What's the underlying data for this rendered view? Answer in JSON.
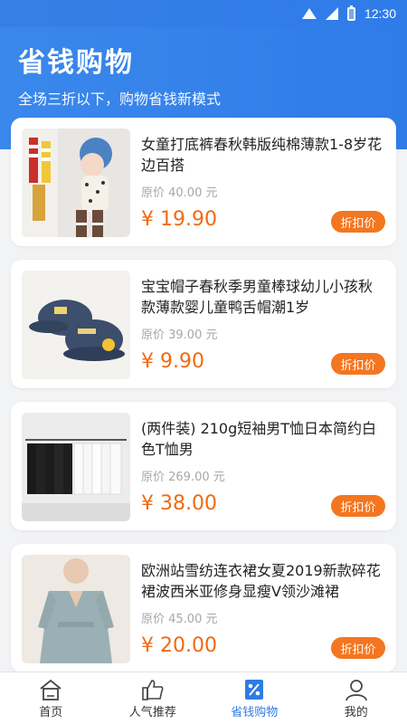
{
  "status_bar": {
    "time": "12:30"
  },
  "header": {
    "title": "省钱购物",
    "subtitle": "全场三折以下，购物省钱新模式"
  },
  "products": [
    {
      "title": "女童打底裤春秋韩版纯棉薄款1-8岁花边百搭",
      "original_price": "原价 40.00 元",
      "price": "¥ 19.90",
      "badge": "折扣价",
      "image": "girl-leggings"
    },
    {
      "title": "宝宝帽子春秋季男童棒球幼儿小孩秋款薄款婴儿童鸭舌帽潮1岁",
      "original_price": "原价 39.00 元",
      "price": "¥ 9.90",
      "badge": "折扣价",
      "image": "baby-caps"
    },
    {
      "title": "(两件装) 210g短袖男T恤日本简约白色T恤男",
      "original_price": "原价 269.00 元",
      "price": "¥ 38.00",
      "badge": "折扣价",
      "image": "tshirts-rack"
    },
    {
      "title": "欧洲站雪纺连衣裙女夏2019新款碎花裙波西米亚修身显瘦V领沙滩裙",
      "original_price": "原价 45.00 元",
      "price": "¥ 20.00",
      "badge": "折扣价",
      "image": "chiffon-dress"
    }
  ],
  "tabbar": {
    "items": [
      {
        "label": "首页",
        "icon": "home-icon"
      },
      {
        "label": "人气推荐",
        "icon": "thumbs-up-icon"
      },
      {
        "label": "省钱购物",
        "icon": "discount-icon",
        "active": true
      },
      {
        "label": "我的",
        "icon": "user-icon"
      }
    ]
  },
  "colors": {
    "primary": "#2f7be8",
    "price": "#f06a13",
    "badge": "#f47620"
  }
}
